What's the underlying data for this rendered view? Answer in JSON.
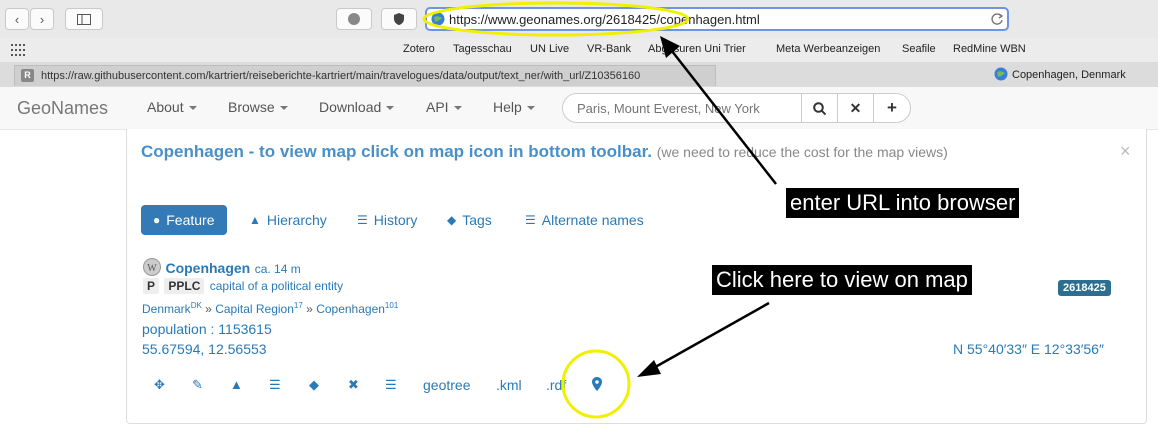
{
  "browser": {
    "url": "https://www.geonames.org/2618425/copenhagen.html",
    "bookmarks": [
      "Zotero",
      "Tagesschau",
      "UN Live",
      "VR-Bank",
      "Abgasuren Uni Trier",
      "Meta Werbeanzeigen",
      "Seafile",
      "RedMine WBN"
    ],
    "tab_url": "https://raw.githubusercontent.com/kartriert/reiseberichte-kartriert/main/travelogues/data/output/text_ner/with_url/Z10356160",
    "tab_title": "Copenhagen, Denmark"
  },
  "site": {
    "logo": "GeoNames",
    "nav": [
      "About",
      "Browse",
      "Download",
      "API",
      "Help"
    ],
    "search_placeholder": "Paris, Mount Everest, New York"
  },
  "panel": {
    "title": "Copenhagen - to view map click on map icon in bottom toolbar.",
    "subtitle": "(we need to reduce the cost for the map views)",
    "tabs": [
      "Feature",
      "Hierarchy",
      "History",
      "Tags",
      "Alternate names"
    ],
    "place_name": "Copenhagen",
    "place_extra": "ca. 14 m",
    "feature_p": "P",
    "feature_code": "PPLC",
    "feature_desc": "capital of a political entity",
    "hierarchy": {
      "country": "Denmark",
      "country_sup": "DK",
      "region": "Capital Region",
      "region_sup": "17",
      "city": "Copenhagen",
      "city_sup": "101"
    },
    "population": "population : 1153615",
    "coords": "55.67594, 12.56553",
    "dms": "N 55°40′33″ E 12°33′56″",
    "geonameid": "2618425",
    "toolbar_text": [
      "geotree",
      ".kml",
      ".rdf"
    ]
  },
  "annotations": {
    "url_note": "enter URL into browser",
    "map_note": "Click here to view on map",
    "highlight_color": "#f0f000"
  }
}
